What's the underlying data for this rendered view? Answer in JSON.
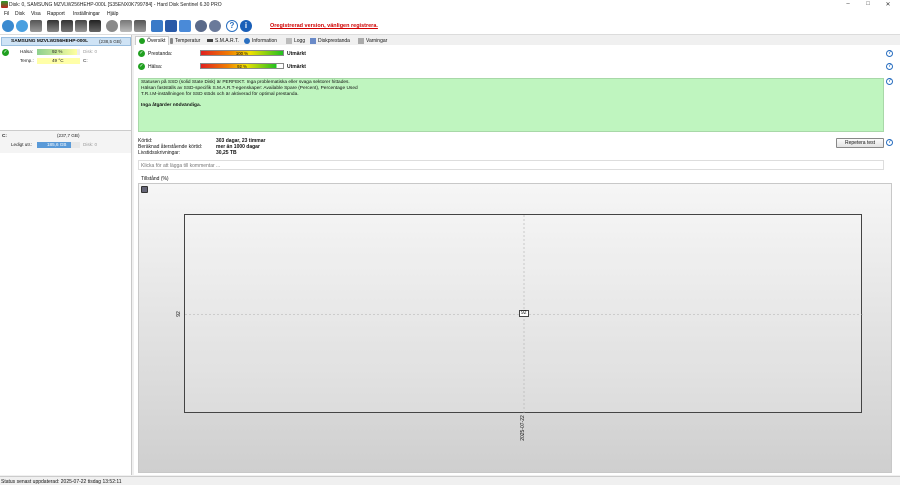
{
  "window": {
    "title": "Disk: 0, SAMSUNG MZVLW256HEHP-000L [S35ENX0K799784] - Hard Disk Sentinel 6.30 PRO",
    "minimize": "–",
    "maximize": "□",
    "close": "✕"
  },
  "menu": [
    "Fil",
    "Disk",
    "Visa",
    "Rapport",
    "Inställningar",
    "Hjälp"
  ],
  "toolbar": {
    "register_link": "Oregistrerad version, vänligen registrera."
  },
  "left": {
    "disk_name": "SAMSUNG MZVLW256HEHP-000L",
    "disk_size": "(238,5 GB)",
    "health_label": "Hälsa:",
    "health_value": "92 %",
    "health_fraction": 0.92,
    "health_disk": "Disk: 0",
    "temp_label": "Temp.:",
    "temp_value": "49 °C",
    "temp_drive": "C:",
    "vol_letter": "C:",
    "vol_size": "(237,7 GB)",
    "free_label": "Ledigt utr.:",
    "free_value": "185,6 GB",
    "free_fraction": 0.78,
    "free_disk": "Disk: 0"
  },
  "tabs": [
    "Översikt",
    "Temperatur",
    "S.M.A.R.T.",
    "Information",
    "Logg",
    "Diskprestanda",
    "Varningar"
  ],
  "overview": {
    "perf_label": "Prestanda:",
    "perf_value": "100 %",
    "perf_fraction": 1.0,
    "perf_rating": "Utmärkt",
    "health_label": "Hälsa:",
    "health_value": "92 %",
    "health_fraction": 0.92,
    "health_rating": "Utmärkt",
    "status_lines": [
      "Statusen på SSD (solid State Disk) är PERFEKT. Inga problematiska eller svaga sektorer hittades.",
      "Hälsan fastställs av SSD-specifik S.M.A.R.T-egenskaper: Available Spare (Percent), Percentage Used",
      "T.R.I.M-inställningen för SSD stöds och är aktiverad för optimal prestanda."
    ],
    "no_action": "Inga åtgärder nödvändiga.",
    "runtime_label": "Körtid:",
    "runtime_value": "303 dagar, 23 timmar",
    "remaining_label": "Beräknad återstående körtid:",
    "remaining_value": "mer än 1000 dagar",
    "writes_label": "Livstidsskrivningar:",
    "writes_value": "30,25 TB",
    "repeat_button": "Repetera test",
    "comment_placeholder": "Klicka för att lägga till kommentar ...",
    "graph_title": "Tillstånd (%)"
  },
  "chart_data": {
    "type": "line",
    "x": [
      "2025-07-22"
    ],
    "series": [
      {
        "values": [
          92
        ]
      }
    ],
    "point_label": "92",
    "ytick": "92",
    "xtick": "2025-07-22"
  },
  "status": {
    "text": "Status senast uppdaterad: 2025-07-22 tisdag 13:52:11"
  },
  "colors": {
    "selected_disk_bg": "#cfe3f5",
    "status_box_bg": "#bff5bf",
    "register_link": "#d00000",
    "ok_green": "#20a020"
  }
}
